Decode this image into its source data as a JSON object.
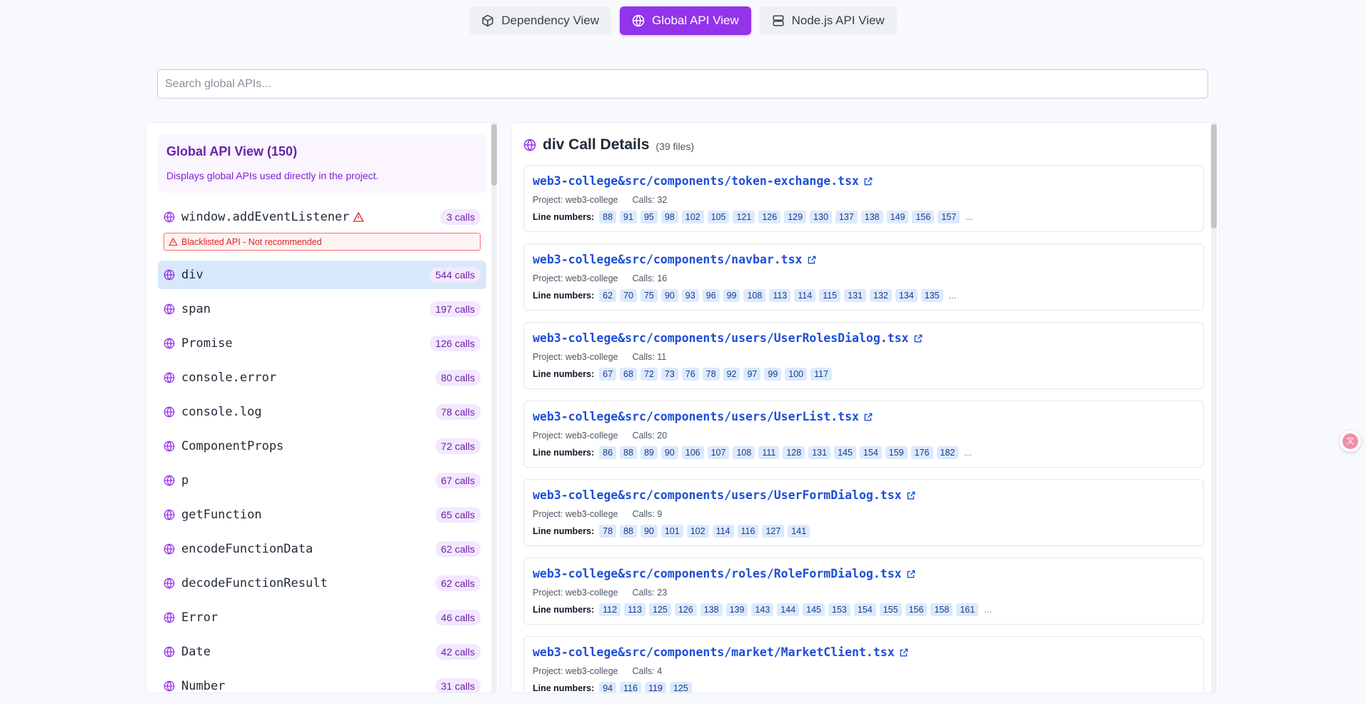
{
  "tabs": [
    {
      "label": "Dependency View",
      "icon": "package-icon",
      "active": false
    },
    {
      "label": "Global API View",
      "icon": "globe-icon",
      "active": true
    },
    {
      "label": "Node.js API View",
      "icon": "server-icon",
      "active": false
    }
  ],
  "search": {
    "placeholder": "Search global APIs...",
    "value": ""
  },
  "left": {
    "title": "Global API View (150)",
    "description": "Displays global APIs used directly in the project.",
    "blacklist_text": "Blacklisted API - Not recommended",
    "items": [
      {
        "name": "window.addEventListener",
        "count": "3 calls"
      },
      {
        "name": "div",
        "count": "544 calls"
      },
      {
        "name": "span",
        "count": "197 calls"
      },
      {
        "name": "Promise",
        "count": "126 calls"
      },
      {
        "name": "console.error",
        "count": "80 calls"
      },
      {
        "name": "console.log",
        "count": "78 calls"
      },
      {
        "name": "ComponentProps",
        "count": "72 calls"
      },
      {
        "name": "p",
        "count": "67 calls"
      },
      {
        "name": "getFunction",
        "count": "65 calls"
      },
      {
        "name": "encodeFunctionData",
        "count": "62 calls"
      },
      {
        "name": "decodeFunctionResult",
        "count": "62 calls"
      },
      {
        "name": "Error",
        "count": "46 calls"
      },
      {
        "name": "Date",
        "count": "42 calls"
      },
      {
        "name": "Number",
        "count": "31 calls"
      }
    ]
  },
  "right": {
    "title": "div Call Details",
    "subtitle": "(39 files)",
    "project_prefix": "Project: web3-college",
    "line_label": "Line numbers:",
    "files": [
      {
        "path": "web3-college&src/components/token-exchange.tsx",
        "calls": "Calls: 32",
        "lines": [
          "88",
          "91",
          "95",
          "98",
          "102",
          "105",
          "121",
          "126",
          "129",
          "130",
          "137",
          "138",
          "149",
          "156",
          "157"
        ],
        "more": true
      },
      {
        "path": "web3-college&src/components/navbar.tsx",
        "calls": "Calls: 16",
        "lines": [
          "62",
          "70",
          "75",
          "90",
          "93",
          "96",
          "99",
          "108",
          "113",
          "114",
          "115",
          "131",
          "132",
          "134",
          "135"
        ],
        "more": true
      },
      {
        "path": "web3-college&src/components/users/UserRolesDialog.tsx",
        "calls": "Calls: 11",
        "lines": [
          "67",
          "68",
          "72",
          "73",
          "76",
          "78",
          "92",
          "97",
          "99",
          "100",
          "117"
        ],
        "more": false
      },
      {
        "path": "web3-college&src/components/users/UserList.tsx",
        "calls": "Calls: 20",
        "lines": [
          "86",
          "88",
          "89",
          "90",
          "106",
          "107",
          "108",
          "111",
          "128",
          "131",
          "145",
          "154",
          "159",
          "176",
          "182"
        ],
        "more": true
      },
      {
        "path": "web3-college&src/components/users/UserFormDialog.tsx",
        "calls": "Calls: 9",
        "lines": [
          "78",
          "88",
          "90",
          "101",
          "102",
          "114",
          "116",
          "127",
          "141"
        ],
        "more": false
      },
      {
        "path": "web3-college&src/components/roles/RoleFormDialog.tsx",
        "calls": "Calls: 23",
        "lines": [
          "112",
          "113",
          "125",
          "126",
          "138",
          "139",
          "143",
          "144",
          "145",
          "153",
          "154",
          "155",
          "156",
          "158",
          "161"
        ],
        "more": true
      },
      {
        "path": "web3-college&src/components/market/MarketClient.tsx",
        "calls": "Calls: 4",
        "lines": [
          "94",
          "116",
          "119",
          "125"
        ],
        "more": false
      }
    ]
  },
  "colors": {
    "accent": "#9333ea",
    "link": "#1d4ed8",
    "danger": "#dc2626"
  }
}
